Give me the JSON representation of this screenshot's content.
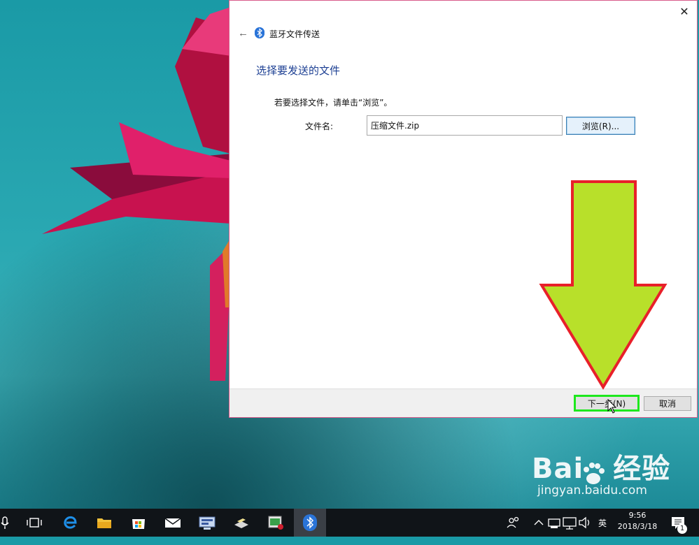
{
  "dialog": {
    "title": "蓝牙文件传送",
    "heading": "选择要发送的文件",
    "instruction": "若要选择文件，请单击“浏览”。",
    "filename_label": "文件名:",
    "filename_value": "压缩文件.zip",
    "browse_label": "浏览(R)...",
    "next_label": "下一步(N)",
    "cancel_label": "取消",
    "close_label": "✕",
    "back_label": "←"
  },
  "taskbar": {
    "ime_label": "英",
    "time": "9:56",
    "date": "2018/3/18",
    "notification_count": "1"
  },
  "watermark": {
    "brand": "Bai",
    "brand_suffix": "经验",
    "url": "jingyan.baidu.com"
  },
  "colors": {
    "highlight_arrow_fill": "#b8e02a",
    "highlight_arrow_border": "#e8202a",
    "next_highlight": "#1de81d",
    "heading": "#1c3f93"
  }
}
